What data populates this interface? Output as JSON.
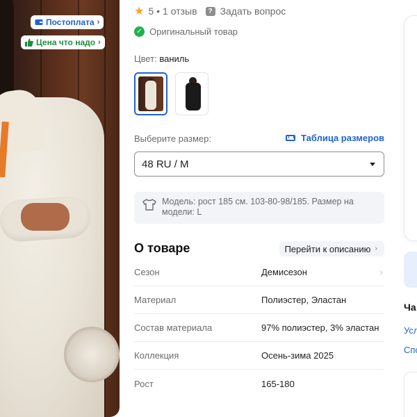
{
  "badges": {
    "payment": "Постоплата",
    "price": "Цена что надо"
  },
  "rating": {
    "value": "5",
    "separator": "•",
    "reviews": "1 отзыв",
    "ask": "Задать вопрос"
  },
  "original": "Оригинальный товар",
  "color": {
    "label": "Цвет:",
    "value": "ваниль",
    "variants": [
      "ваниль",
      "черный"
    ]
  },
  "size": {
    "label": "Выберите размер:",
    "table_link": "Таблица размеров",
    "selected": "48 RU / M"
  },
  "model_info": "Модель: рост 185 см. 103-80-98/185. Размер на модели: L",
  "about": {
    "title": "О товаре",
    "link": "Перейти к описанию"
  },
  "specs": [
    {
      "key": "Сезон",
      "value": "Демисезон"
    },
    {
      "key": "Материал",
      "value": "Полиэстер, Эластан"
    },
    {
      "key": "Состав материала",
      "value": "97% полиэстер, 3% эластан"
    },
    {
      "key": "Коллекция",
      "value": "Осень-зима 2025"
    },
    {
      "key": "Рост",
      "value": "165-180"
    }
  ],
  "side": {
    "heading": "Ча",
    "link1": "Усл",
    "link2": "Спо"
  },
  "colors": {
    "accent": "#1e63d6",
    "green": "#21b14a",
    "star": "#f5a623"
  }
}
